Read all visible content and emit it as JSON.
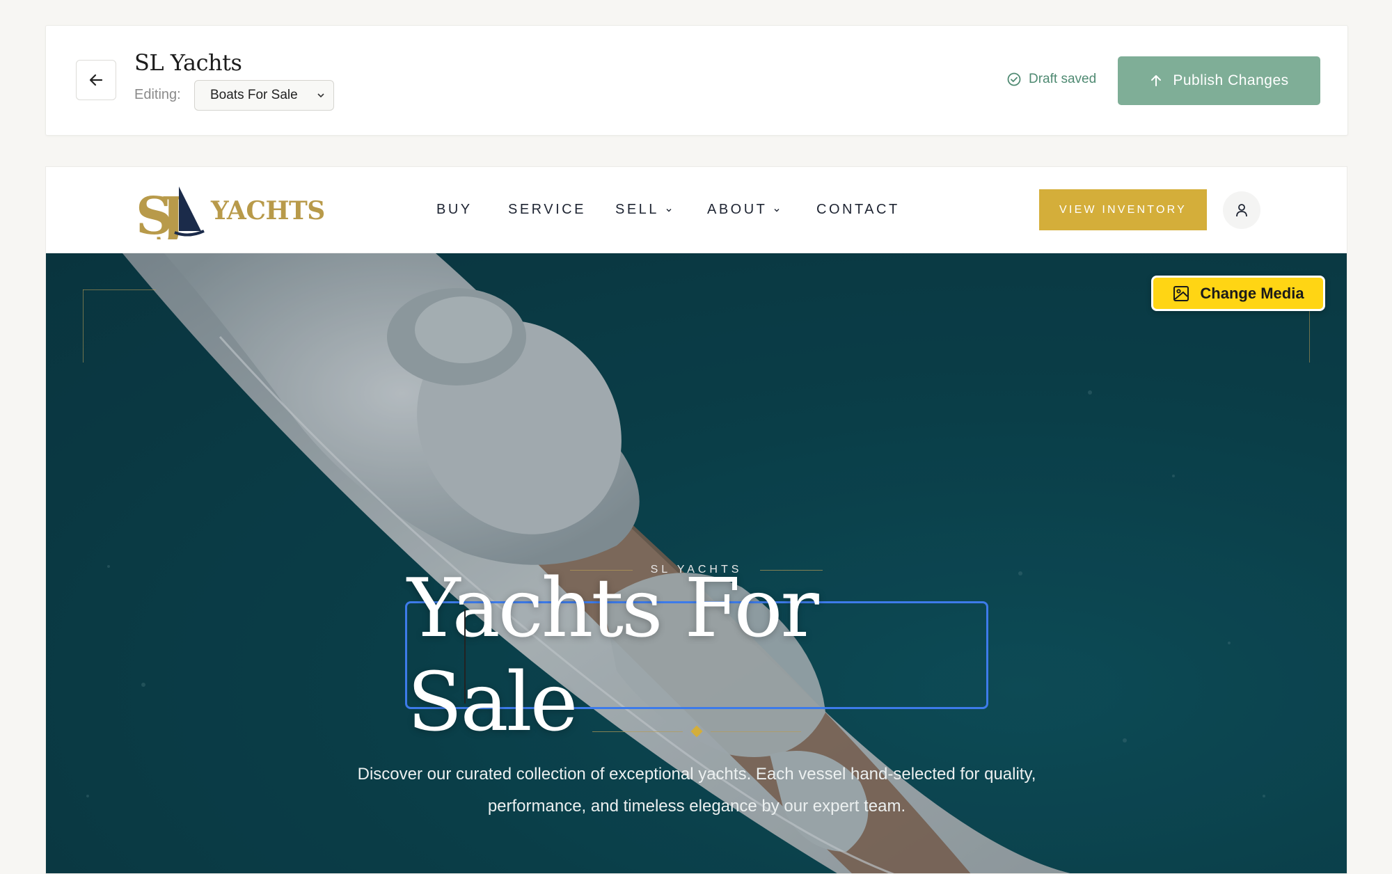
{
  "editor": {
    "site_title": "SL Yachts",
    "editing_label": "Editing:",
    "selected_page": "Boats For Sale",
    "draft_status": "Draft saved",
    "publish_label": "Publish Changes"
  },
  "site": {
    "logo_text": "YACHTS",
    "nav": [
      {
        "label": "BUY"
      },
      {
        "label": "SERVICE"
      },
      {
        "label": "SELL"
      },
      {
        "label": "ABOUT"
      },
      {
        "label": "CONTACT"
      }
    ],
    "cta_label": "VIEW INVENTORY"
  },
  "hero": {
    "change_media_label": "Change Media",
    "eyebrow": "SL YACHTS",
    "headline": "Yachts For Sale",
    "subtext": "Discover our curated collection of exceptional yachts. Each vessel hand-selected for quality, performance, and timeless elegance by our expert team."
  },
  "colors": {
    "accent_gold": "#d4ae3a",
    "publish_green": "#7fae97",
    "selection_blue": "#3d7bea",
    "media_yellow": "#ffd514"
  }
}
